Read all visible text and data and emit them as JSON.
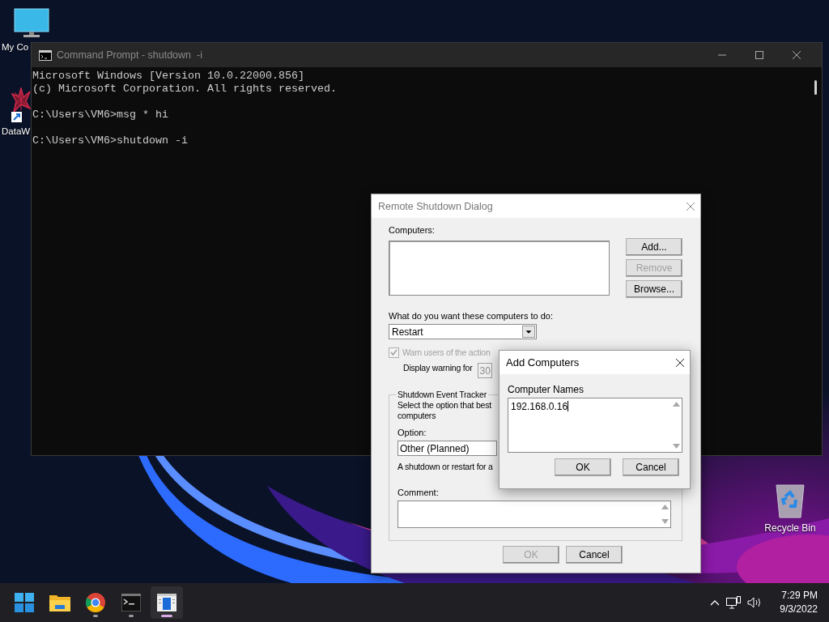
{
  "desktop": {
    "icons": [
      {
        "kind": "computer",
        "label": "My Co"
      },
      {
        "kind": "app",
        "label": "DataW"
      },
      {
        "kind": "recycle_bin",
        "label": "Recycle Bin"
      }
    ]
  },
  "command_prompt": {
    "title": "Command Prompt - shutdown  -i",
    "blocks": [
      [
        "Microsoft Windows [Version 10.0.22000.856]",
        "(c) Microsoft Corporation. All rights reserved."
      ],
      [
        "C:\\Users\\VM6>msg * hi"
      ],
      [
        "C:\\Users\\VM6>shutdown -i"
      ]
    ]
  },
  "remote_shutdown_dialog": {
    "title": "Remote Shutdown Dialog",
    "computers_label": "Computers:",
    "side_buttons": [
      {
        "label": "Add...",
        "disabled": false
      },
      {
        "label": "Remove",
        "disabled": true
      },
      {
        "label": "Browse...",
        "disabled": false
      }
    ],
    "action_label": "What do you want these computers to do:",
    "action_value": "Restart",
    "warn_checkbox": {
      "label": "Warn users of the action",
      "checked": true,
      "disabled": true
    },
    "warning_label": "Display warning for",
    "warning_value": "30",
    "tracker": {
      "title": "Shutdown Event Tracker",
      "description_lines": [
        "Select the option that best",
        "computers"
      ],
      "option_label": "Option:",
      "option_value": "Other (Planned)",
      "option_description": "A shutdown or restart for a",
      "comment_label": "Comment:"
    },
    "buttons": [
      {
        "label": "OK",
        "disabled": true
      },
      {
        "label": "Cancel",
        "disabled": false
      }
    ]
  },
  "add_computers_dialog": {
    "title": "Add Computers",
    "names_label": "Computer Names",
    "names_value": "192.168.0.16",
    "buttons": [
      {
        "label": "OK",
        "disabled": false
      },
      {
        "label": "Cancel",
        "disabled": false
      }
    ]
  },
  "taskbar": {
    "apps": [
      {
        "kind": "start",
        "running": false,
        "selected": false
      },
      {
        "kind": "folder",
        "running": false,
        "selected": false
      },
      {
        "kind": "browser",
        "running": true,
        "selected": false
      },
      {
        "kind": "terminal",
        "running": true,
        "selected": false
      },
      {
        "kind": "dialog",
        "running": true,
        "selected": true
      }
    ],
    "clock": {
      "time": "7:29 PM",
      "date": "9/3/2022"
    }
  }
}
